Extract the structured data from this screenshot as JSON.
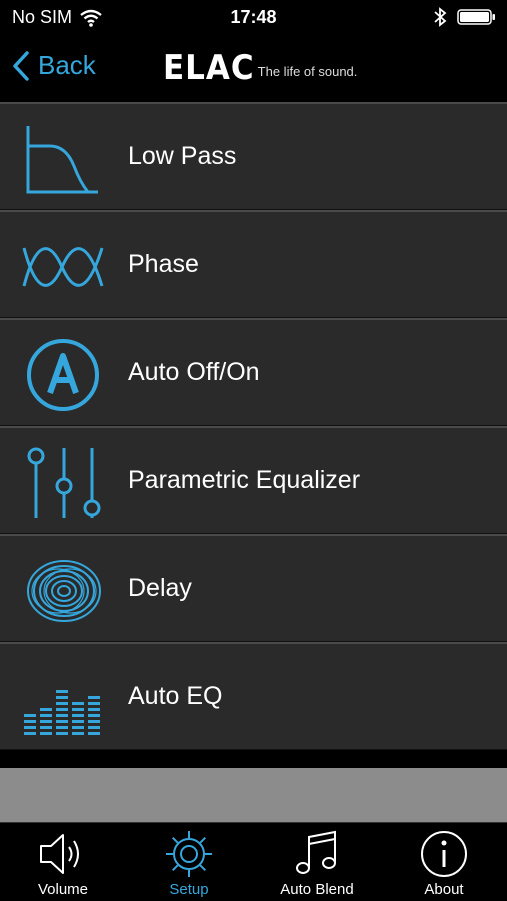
{
  "status_bar": {
    "carrier": "No SIM",
    "time": "17:48"
  },
  "nav": {
    "back_label": "Back",
    "brand": "ELAC",
    "tagline": "The life of sound."
  },
  "menu": [
    {
      "label": "Low Pass",
      "icon": "low-pass-filter-icon"
    },
    {
      "label": "Phase",
      "icon": "phase-wave-icon"
    },
    {
      "label": "Auto Off/On",
      "icon": "auto-a-circle-icon"
    },
    {
      "label": "Parametric Equalizer",
      "icon": "equalizer-sliders-icon"
    },
    {
      "label": "Delay",
      "icon": "delay-rings-icon"
    },
    {
      "label": "Auto EQ",
      "icon": "auto-eq-bars-icon"
    }
  ],
  "tabs": [
    {
      "label": "Volume",
      "icon": "speaker-icon",
      "active": false
    },
    {
      "label": "Setup",
      "icon": "gear-icon",
      "active": true
    },
    {
      "label": "Auto Blend",
      "icon": "music-note-icon",
      "active": false
    },
    {
      "label": "About",
      "icon": "info-icon",
      "active": false
    }
  ],
  "colors": {
    "accent": "#35a7dc",
    "row_background": "#2a2a2a",
    "filler": "#8c8c8c"
  }
}
